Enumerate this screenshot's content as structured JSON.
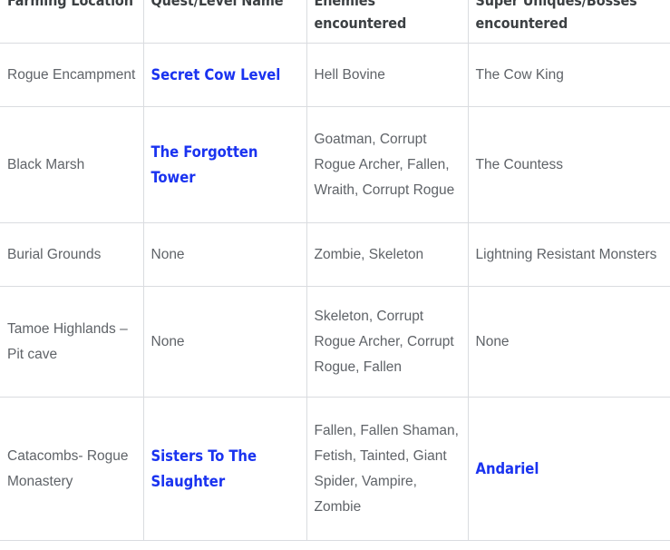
{
  "table": {
    "name": "diablo-2-act-1-farming-table",
    "columns": [
      {
        "id": "farming_location",
        "label": "Farming Location"
      },
      {
        "id": "quest_level_name",
        "label": "Quest/Level Name"
      },
      {
        "id": "enemies_encountered",
        "label": "Enemies encountered"
      },
      {
        "id": "super_uniques_bosses",
        "label": "Super Uniques/Bosses encountered"
      }
    ],
    "rows": [
      {
        "farming_location": "Rogue Encampment",
        "quest_level_name": "Secret Cow Level",
        "quest_is_link": true,
        "enemies_encountered": "Hell Bovine",
        "super_uniques_bosses": "The Cow King",
        "boss_is_link": false
      },
      {
        "farming_location": "Black Marsh",
        "quest_level_name": "The Forgotten Tower",
        "quest_is_link": true,
        "enemies_encountered": "Goatman, Corrupt Rogue Archer, Fallen, Wraith, Corrupt Rogue",
        "super_uniques_bosses": "The Countess",
        "boss_is_link": false
      },
      {
        "farming_location": "Burial Grounds",
        "quest_level_name": "None",
        "quest_is_link": false,
        "enemies_encountered": "Zombie, Skeleton",
        "super_uniques_bosses": "Lightning Resistant Monsters",
        "boss_is_link": false
      },
      {
        "farming_location": "Tamoe Highlands – Pit cave",
        "quest_level_name": "None",
        "quest_is_link": false,
        "enemies_encountered": "Skeleton, Corrupt Rogue Archer, Corrupt Rogue, Fallen",
        "super_uniques_bosses": "None",
        "boss_is_link": false
      },
      {
        "farming_location": "Catacombs- Rogue Monastery",
        "quest_level_name": "Sisters To The Slaughter",
        "quest_is_link": true,
        "enemies_encountered": "Fallen, Fallen Shaman, Fetish, Tainted, Giant Spider, Vampire, Zombie",
        "super_uniques_bosses": "Andariel",
        "boss_is_link": true
      }
    ]
  },
  "colors": {
    "link": "#1a33f0",
    "header_text": "#3c4043",
    "body_text": "#5f6368",
    "border": "#dadce0",
    "background": "#ffffff"
  }
}
